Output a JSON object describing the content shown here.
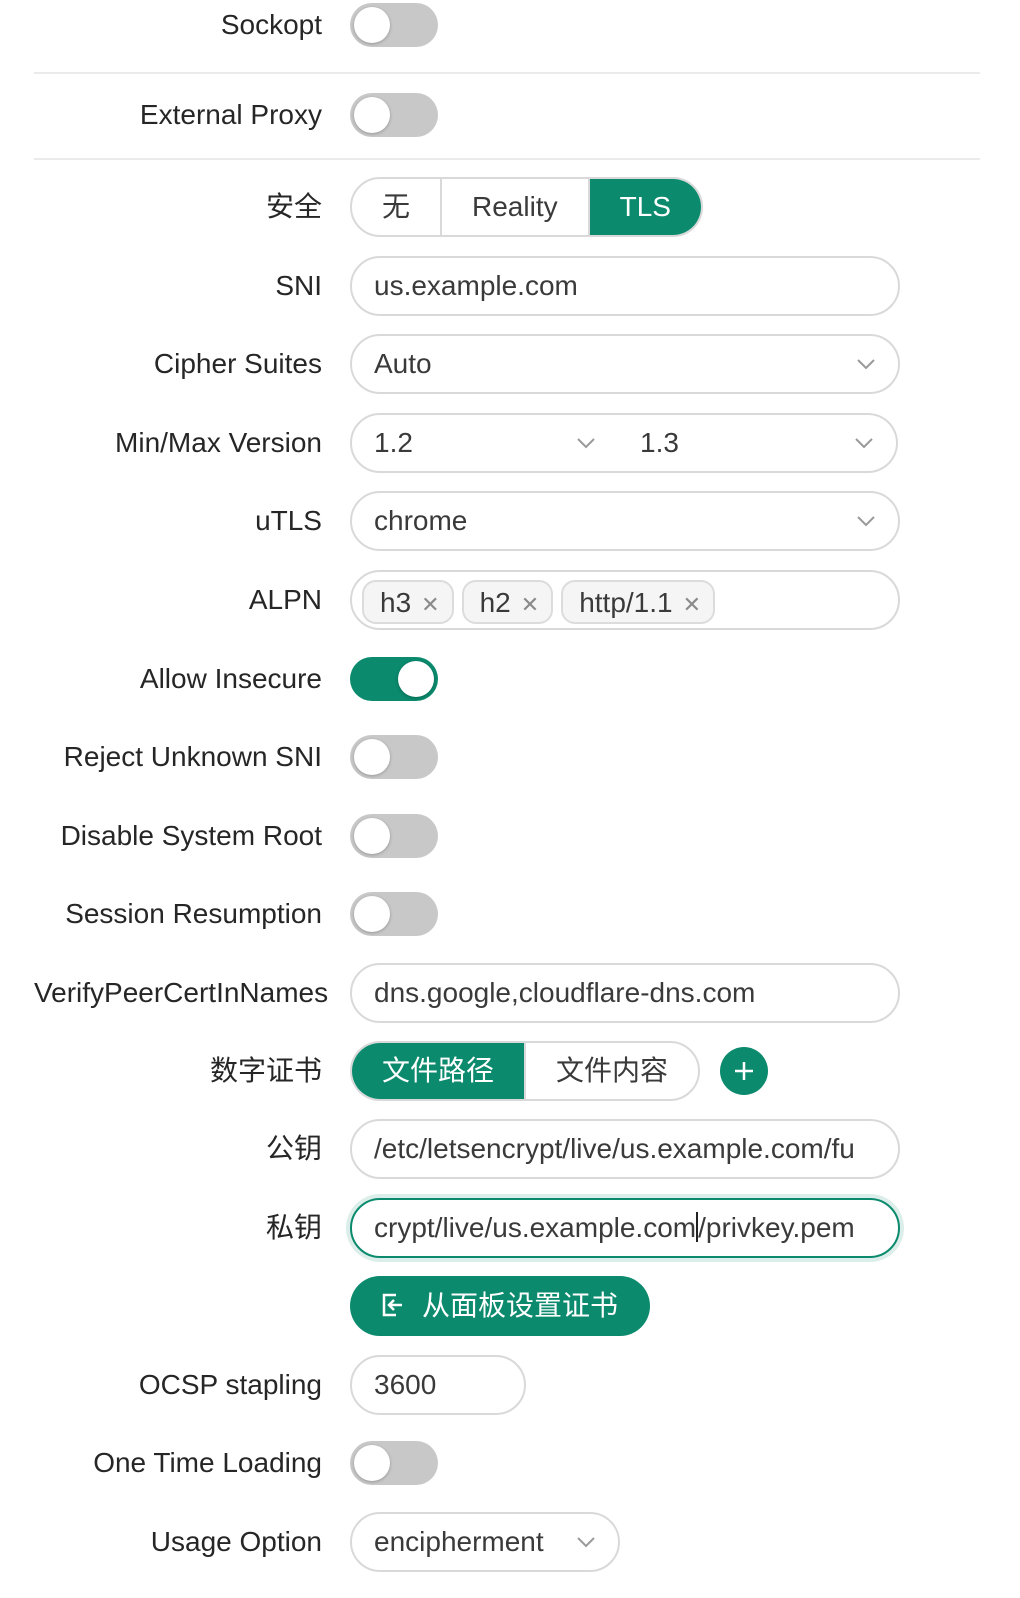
{
  "sockopt": {
    "label": "Sockopt",
    "on": false
  },
  "external_proxy": {
    "label": "External Proxy",
    "on": false
  },
  "security": {
    "label": "安全",
    "options": [
      "无",
      "Reality",
      "TLS"
    ],
    "selected": "TLS"
  },
  "sni": {
    "label": "SNI",
    "value": "us.example.com"
  },
  "cipher_suites": {
    "label": "Cipher Suites",
    "value": "Auto"
  },
  "version": {
    "label": "Min/Max Version",
    "min": "1.2",
    "max": "1.3"
  },
  "utls": {
    "label": "uTLS",
    "value": "chrome"
  },
  "alpn": {
    "label": "ALPN",
    "tags": [
      "h3",
      "h2",
      "http/1.1"
    ]
  },
  "allow_insecure": {
    "label": "Allow Insecure",
    "on": true
  },
  "reject_unknown_sni": {
    "label": "Reject Unknown SNI",
    "on": false
  },
  "disable_system_root": {
    "label": "Disable System Root",
    "on": false
  },
  "session_resumption": {
    "label": "Session Resumption",
    "on": false
  },
  "verify_peer": {
    "label": "VerifyPeerCertInNames",
    "value": "dns.google,cloudflare-dns.com"
  },
  "certificate": {
    "label": "数字证书",
    "options": [
      "文件路径",
      "文件内容"
    ],
    "selected": "文件路径"
  },
  "public_key": {
    "label": "公钥",
    "value": "/etc/letsencrypt/live/us.example.com/fu"
  },
  "private_key": {
    "label": "私钥",
    "value_before_caret": "crypt/live/us.example.com",
    "value_after_caret": "/privkey.pem"
  },
  "set_cert_button": {
    "label": "从面板设置证书"
  },
  "ocsp": {
    "label": "OCSP stapling",
    "value": "3600"
  },
  "one_time_loading": {
    "label": "One Time Loading",
    "on": false
  },
  "usage_option": {
    "label": "Usage Option",
    "value": "encipherment"
  },
  "colors": {
    "accent": "#0b8a6d",
    "toggle_off": "#c8c8c8"
  }
}
